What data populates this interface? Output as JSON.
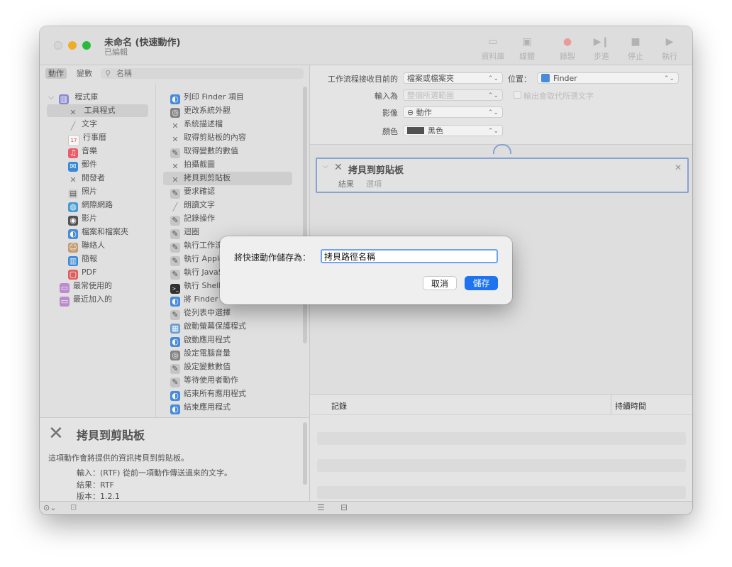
{
  "window": {
    "title": "未命名 (快速動作)",
    "subtitle": "已編輯"
  },
  "toolbar": [
    {
      "id": "library",
      "label": "資料庫",
      "icon": "sidebar-icon"
    },
    {
      "id": "media",
      "label": "媒體",
      "icon": "photo-icon"
    },
    {
      "id": "record",
      "label": "錄製",
      "icon": "record-icon"
    },
    {
      "id": "step",
      "label": "步進",
      "icon": "step-icon"
    },
    {
      "id": "stop",
      "label": "停止",
      "icon": "stop-icon"
    },
    {
      "id": "run",
      "label": "執行",
      "icon": "play-icon"
    }
  ],
  "left": {
    "tabs": [
      "動作",
      "變數"
    ],
    "search_placeholder": "名稱",
    "library_root": "程式庫",
    "library_items": [
      "工具程式",
      "文字",
      "行事曆",
      "音樂",
      "郵件",
      "開發者",
      "照片",
      "網際網路",
      "影片",
      "檔案和檔案夾",
      "聯絡人",
      "簡報",
      "PDF"
    ],
    "library_extras": [
      "最常使用的",
      "最近加入的"
    ],
    "actions": [
      "列印 Finder 項目",
      "更改系統外觀",
      "系統描述檔",
      "取得剪貼板的內容",
      "取得變數的數值",
      "拍攝截圖",
      "拷貝到剪貼板",
      "要求確認",
      "朗讀文字",
      "記錄操作",
      "迴圈",
      "執行工作流",
      "執行 Apple",
      "執行 JavaS",
      "執行 Shell",
      "將 Finder",
      "從列表中選擇",
      "啟動螢幕保護程式",
      "啟動應用程式",
      "設定電腦音量",
      "設定變數數值",
      "等待使用者動作",
      "結束所有應用程式",
      "結束應用程式"
    ],
    "description": {
      "title": "拷貝到剪貼板",
      "text": "這項動作會將提供的資訊拷貝到剪貼板。",
      "input_label": "輸入：",
      "input_value": "(RTF) 從前一項動作傳送過來的文字。",
      "result_label": "結果：",
      "result_value": "RTF",
      "version_label": "版本：",
      "version_value": "1.2.1"
    }
  },
  "right": {
    "receives_label": "工作流程接收目前的",
    "receives_value": "檔案或檔案夾",
    "location_label": "位置：",
    "location_value": "Finder",
    "input_is_label": "輸入為",
    "input_is_value": "整個所選範圍",
    "replace_output_label": "輸出會取代所選文字",
    "image_label": "影像",
    "image_value": "⊖ 動作",
    "color_label": "顏色",
    "color_value": "黑色",
    "card_title": "拷貝到剪貼板",
    "card_tabs": [
      "結果",
      "選項"
    ],
    "log_col1": "記錄",
    "log_col2": "持續時間"
  },
  "dialog": {
    "label": "將快速動作儲存為：",
    "value": "拷貝路徑名稱",
    "cancel": "取消",
    "save": "儲存"
  },
  "colors": {
    "accent": "#1d73f0",
    "focus": "#6ea4f2",
    "card_border": "#8ca9d8"
  }
}
